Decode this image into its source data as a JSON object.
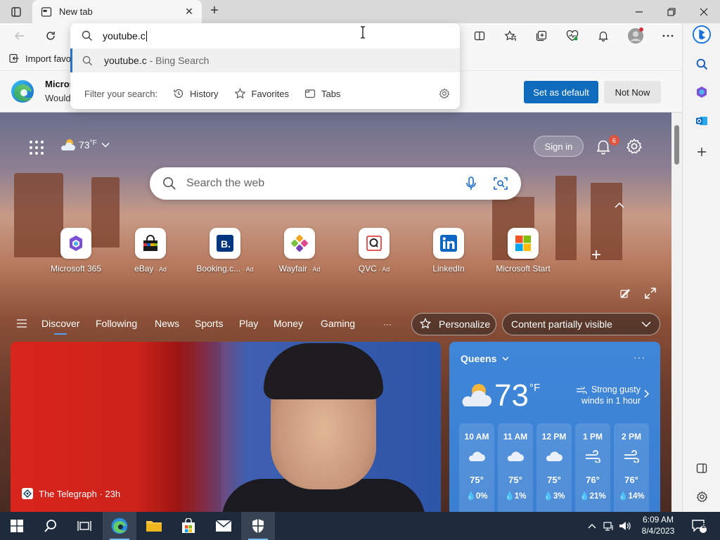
{
  "browser": {
    "tab_title": "New tab",
    "address_text": "youtube.c",
    "suggestion": {
      "query": "youtube.c",
      "suffix": " - Bing Search"
    },
    "filter_label": "Filter your search:",
    "filters": [
      "History",
      "Favorites",
      "Tabs"
    ]
  },
  "favbar": {
    "import_label": "Import favo"
  },
  "promo": {
    "title": "Micros",
    "subtitle": "Would",
    "set_default": "Set as default",
    "not_now": "Not Now"
  },
  "ntp": {
    "weather_temp": "73",
    "weather_unit": "°F",
    "sign_in": "Sign in",
    "notif_count": "6",
    "search_placeholder": "Search the web",
    "quicklinks": [
      {
        "label": "Microsoft 365",
        "ad": ""
      },
      {
        "label": "eBay",
        "ad": " · Ad"
      },
      {
        "label": "Booking.c...",
        "ad": " · Ad"
      },
      {
        "label": "Wayfair",
        "ad": " · Ad"
      },
      {
        "label": "QVC",
        "ad": " · Ad"
      },
      {
        "label": "LinkedIn",
        "ad": ""
      },
      {
        "label": "Microsoft Start",
        "ad": ""
      }
    ],
    "nav": [
      "Discover",
      "Following",
      "News",
      "Sports",
      "Play",
      "Money",
      "Gaming"
    ],
    "nav_more": "···",
    "personalize": "Personalize",
    "content_visibility": "Content partially visible"
  },
  "news": {
    "source": "The Telegraph · 23h"
  },
  "weather_card": {
    "location": "Queens",
    "more": "···",
    "temp": "73",
    "unit": "°F",
    "alert": "Strong gusty winds in 1 hour",
    "hours": [
      {
        "time": "10 AM",
        "temp": "75°",
        "precip": "0%",
        "icon": "cloud-icon"
      },
      {
        "time": "11 AM",
        "temp": "75°",
        "precip": "1%",
        "icon": "cloud-icon"
      },
      {
        "time": "12 PM",
        "temp": "75°",
        "precip": "3%",
        "icon": "cloud-icon"
      },
      {
        "time": "1 PM",
        "temp": "76°",
        "precip": "21%",
        "icon": "wind-icon"
      },
      {
        "time": "2 PM",
        "temp": "76°",
        "precip": "14%",
        "icon": "wind-icon"
      }
    ]
  },
  "taskbar": {
    "time": "6:09 AM",
    "date": "8/4/2023",
    "notifications": "2"
  },
  "colors": {
    "accent": "#0f6cbd",
    "taskbar": "#1d2b3c",
    "weather": "#3f86d9"
  }
}
